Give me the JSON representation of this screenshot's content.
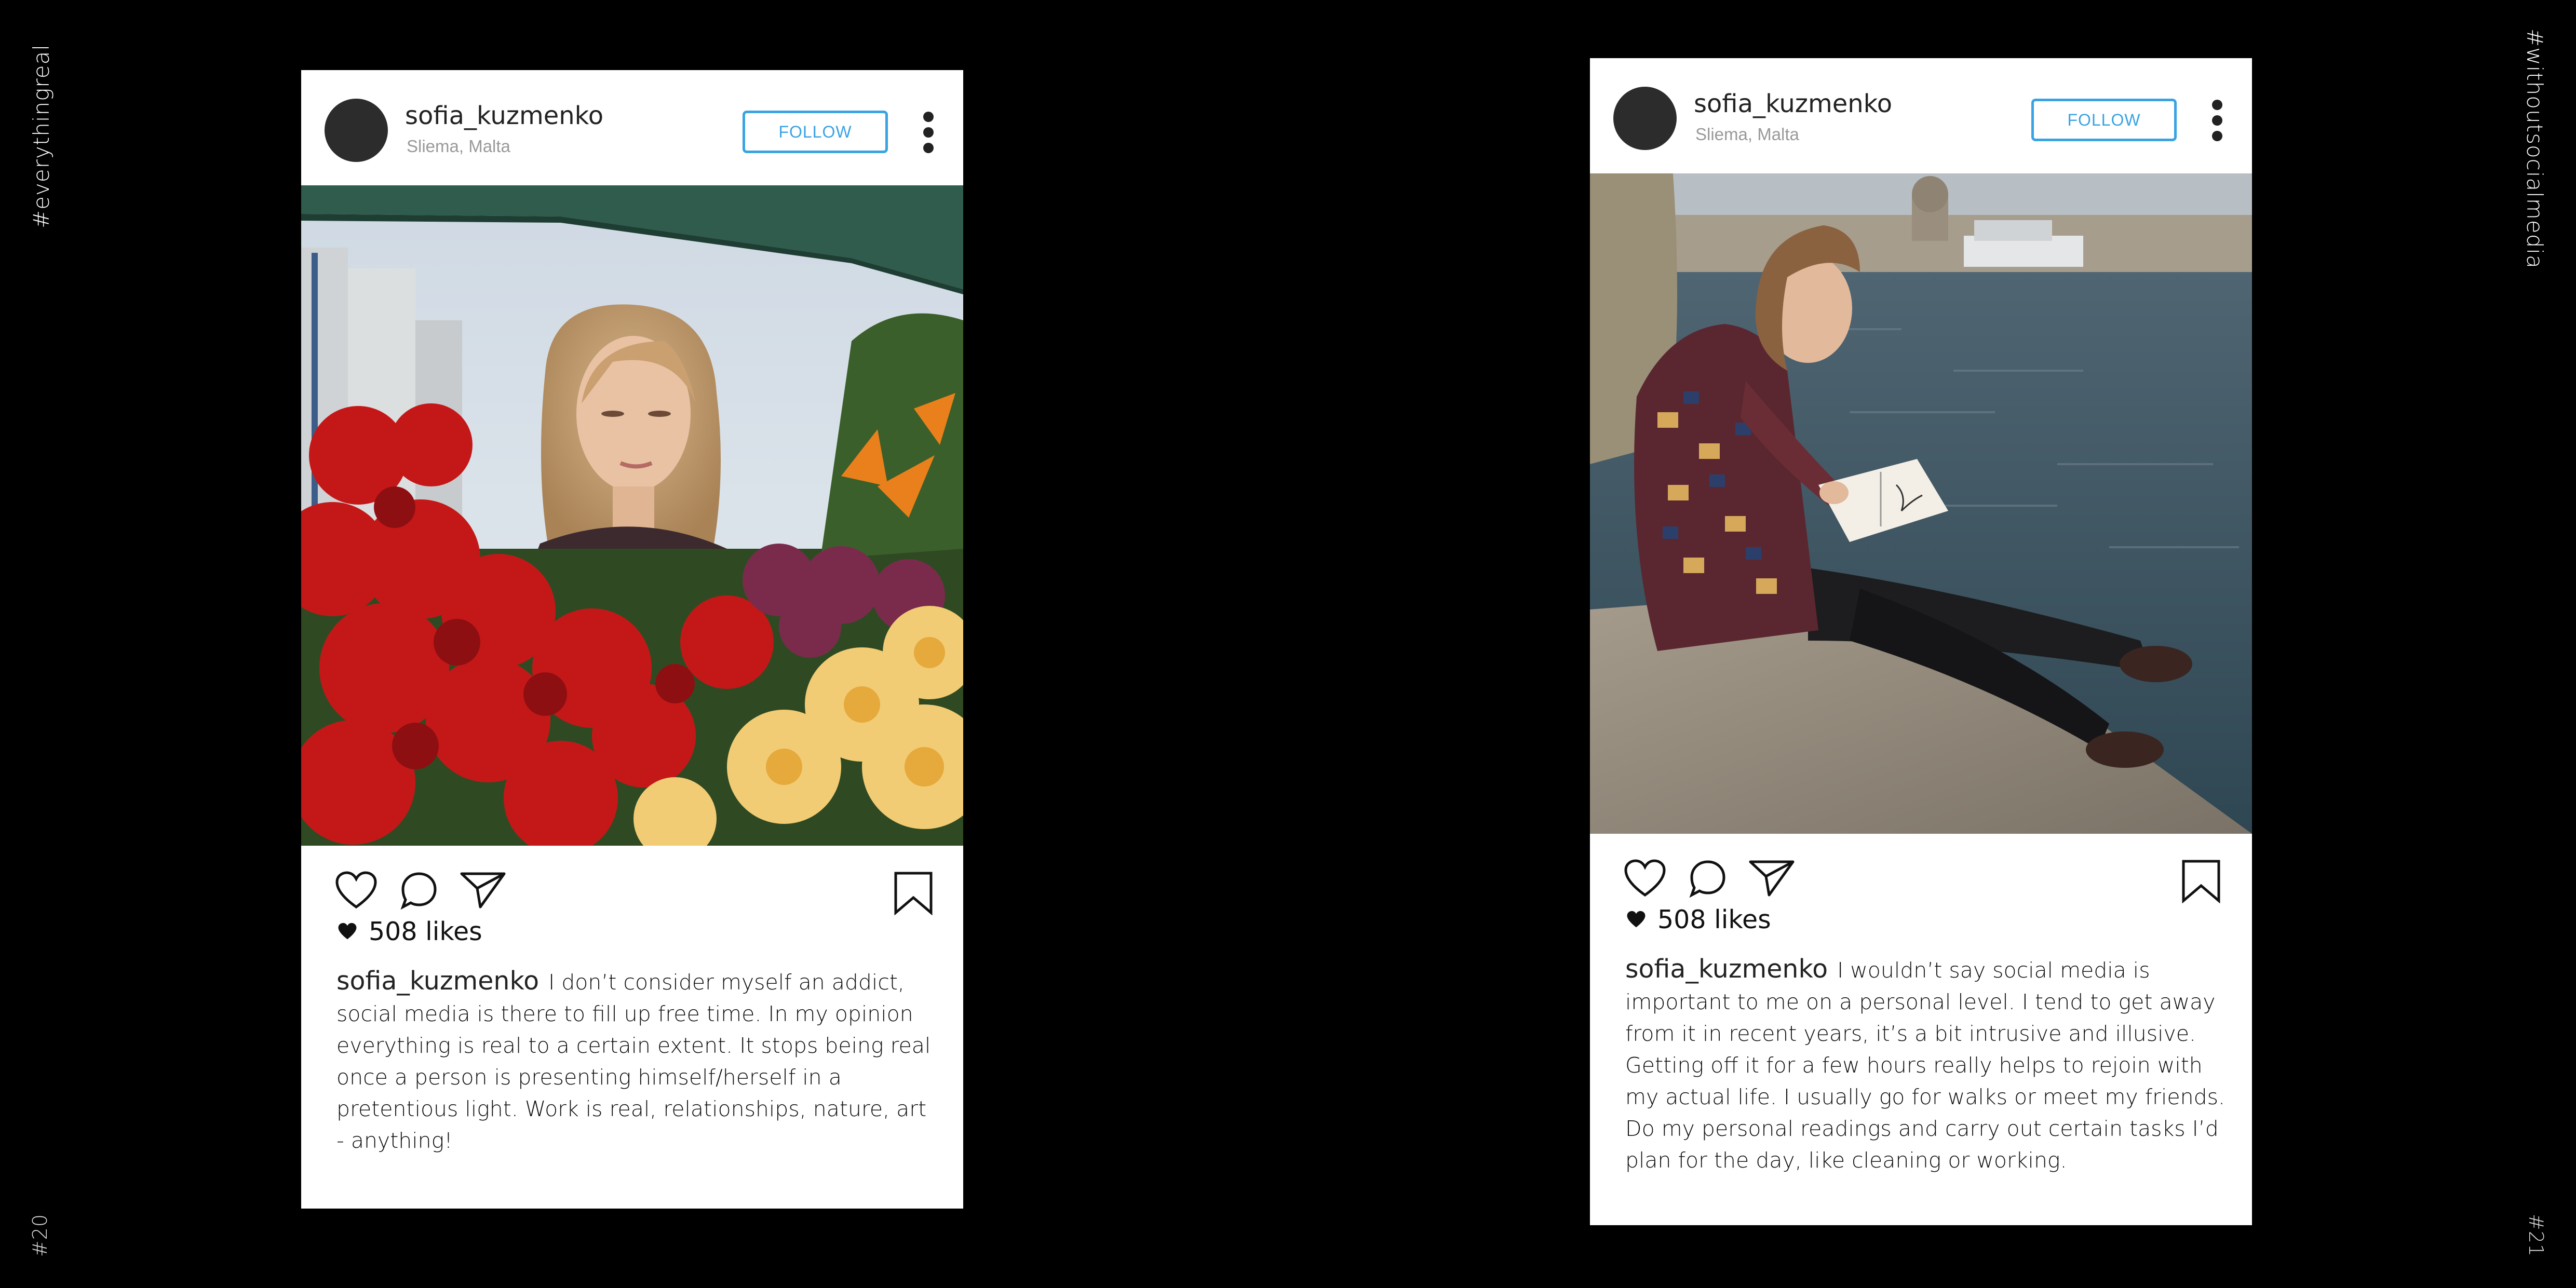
{
  "side_labels": {
    "left_tag": "#everythingreal",
    "right_tag": "#withoutsocialmedia",
    "left_page": "#20",
    "right_page": "#21"
  },
  "posts": [
    {
      "username": "sofia_kuzmenko",
      "location": "Sliema, Malta",
      "follow_label": "FOLLOW",
      "likes": "508 likes",
      "caption_user": "sofia_kuzmenko",
      "caption_text": "I don’t consider myself an addict, social media is there to fill up free time. In my opinion everything is real to a certain extent. It stops being real once a person is presenting himself/herself in a pretentious light. Work is real, relationships, nature, art - anything!",
      "photo": "woman-with-flowers-market"
    },
    {
      "username": "sofia_kuzmenko",
      "location": "Sliema, Malta",
      "follow_label": "FOLLOW",
      "likes": "508 likes",
      "caption_user": "sofia_kuzmenko",
      "caption_text": "I wouldn’t say social media is important to me on a personal level. I tend to get away from it in recent years, it’s a bit intrusive and illusive. Getting off it for a few hours really helps to rejoin with my actual life. I usually go for walks or meet my friends. Do my personal readings and carry out certain tasks I’d plan for the day, like cleaning or working.",
      "photo": "woman-drawing-by-harbour"
    }
  ],
  "colors": {
    "background": "#000000",
    "card": "#ffffff",
    "follow_accent": "#3aa3e3",
    "avatar": "#2c2c2c"
  }
}
